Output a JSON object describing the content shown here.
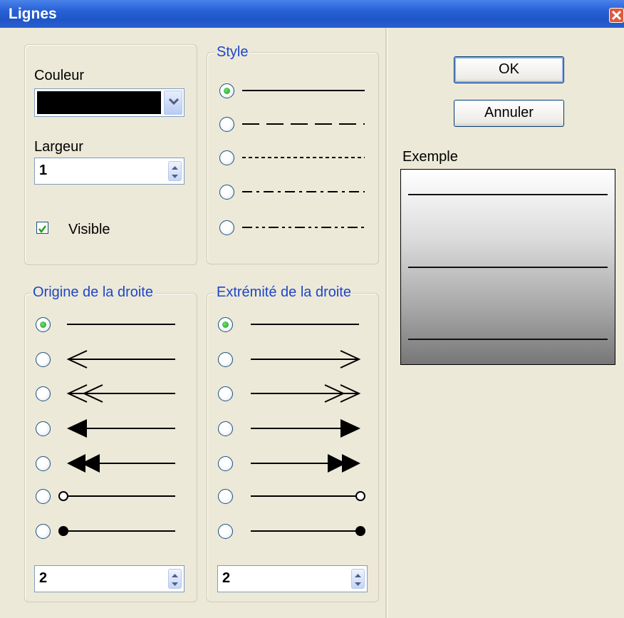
{
  "window": {
    "title": "Lignes"
  },
  "buttons": {
    "ok": "OK",
    "cancel": "Annuler"
  },
  "appearance": {
    "color_label": "Couleur",
    "color_value": "#000000",
    "width_label": "Largeur",
    "width_value": "1",
    "visible_label": "Visible",
    "visible_checked": true
  },
  "style_group": {
    "legend": "Style",
    "options": [
      "solid",
      "dashed",
      "dotted",
      "dash-dot",
      "dash-dot-dot"
    ],
    "selected_index": 0
  },
  "origin_group": {
    "legend": "Origine de la droite",
    "options": [
      "none",
      "open-arrow",
      "double-open-arrow",
      "filled-arrow",
      "double-filled-arrow",
      "open-circle",
      "filled-circle"
    ],
    "selected_index": 0,
    "size_value": "2"
  },
  "end_group": {
    "legend": "Extrémité de la droite",
    "options": [
      "none",
      "open-arrow",
      "double-open-arrow",
      "filled-arrow",
      "double-filled-arrow",
      "open-circle",
      "filled-circle"
    ],
    "selected_index": 0,
    "size_value": "2"
  },
  "preview": {
    "label": "Exemple"
  }
}
